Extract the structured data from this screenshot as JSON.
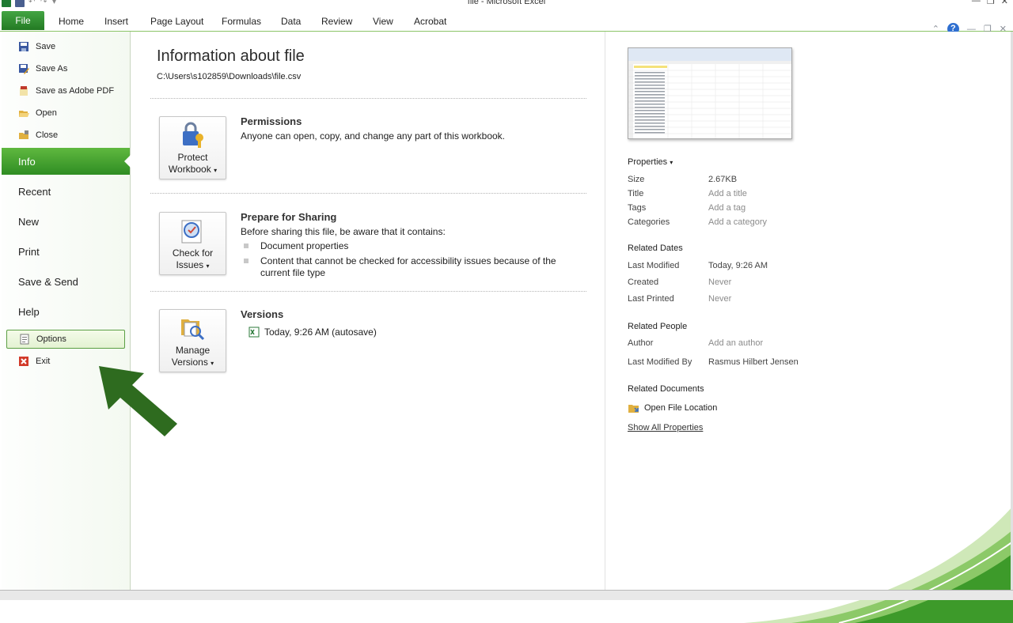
{
  "window": {
    "title": "file - Microsoft Excel"
  },
  "ribbon": {
    "file_tab": "File",
    "tabs": [
      "Home",
      "Insert",
      "Page Layout",
      "Formulas",
      "Data",
      "Review",
      "View",
      "Acrobat"
    ],
    "help": "?"
  },
  "nav": {
    "save": "Save",
    "save_as": "Save As",
    "save_as_pdf": "Save as Adobe PDF",
    "open": "Open",
    "close": "Close",
    "info": "Info",
    "recent": "Recent",
    "new": "New",
    "print": "Print",
    "save_send": "Save & Send",
    "help": "Help",
    "options": "Options",
    "exit": "Exit"
  },
  "info": {
    "title": "Information about file",
    "path": "C:\\Users\\s102859\\Downloads\\file.csv",
    "permissions": {
      "button_line1": "Protect",
      "button_line2": "Workbook",
      "title": "Permissions",
      "text": "Anyone can open, copy, and change any part of this workbook."
    },
    "sharing": {
      "button_line1": "Check for",
      "button_line2": "Issues",
      "title": "Prepare for Sharing",
      "text": "Before sharing this file, be aware that it contains:",
      "items": [
        "Document properties",
        "Content that cannot be checked for accessibility issues because of the current file type"
      ]
    },
    "versions": {
      "button_line1": "Manage",
      "button_line2": "Versions",
      "title": "Versions",
      "entry": "Today, 9:26 AM (autosave)"
    }
  },
  "properties": {
    "header": "Properties",
    "size_label": "Size",
    "size": "2.67KB",
    "title_label": "Title",
    "title": "Add a title",
    "tags_label": "Tags",
    "tags": "Add a tag",
    "categories_label": "Categories",
    "categories": "Add a category",
    "dates_header": "Related Dates",
    "modified_label": "Last Modified",
    "modified": "Today, 9:26 AM",
    "created_label": "Created",
    "created": "Never",
    "printed_label": "Last Printed",
    "printed": "Never",
    "people_header": "Related People",
    "author_label": "Author",
    "author": "Add an author",
    "modified_by_label": "Last Modified By",
    "modified_by": "Rasmus Hilbert Jensen",
    "docs_header": "Related Documents",
    "open_location": "Open File Location",
    "show_all": "Show All Properties"
  },
  "colors": {
    "accent": "#2f8d23",
    "arrow": "#2e6b1f"
  }
}
